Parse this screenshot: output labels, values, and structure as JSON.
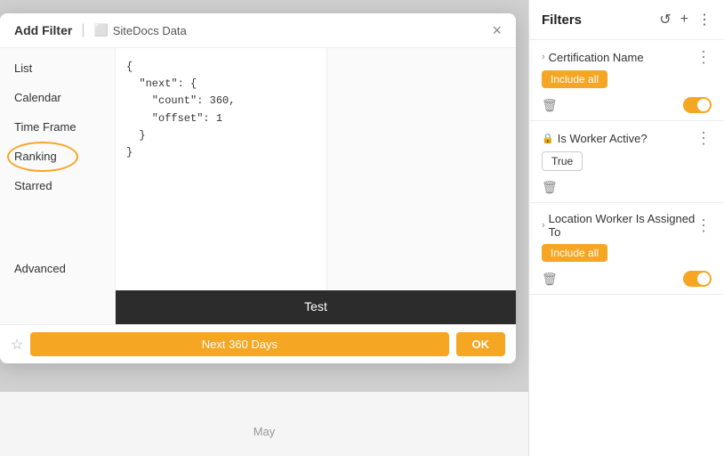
{
  "dialog": {
    "title": "Add Filter",
    "subtitle": "SiteDocs Data",
    "subtitle_icon": "document-icon",
    "close_label": "×",
    "sidebar": {
      "items": [
        {
          "label": "List",
          "active": false
        },
        {
          "label": "Calendar",
          "active": false
        },
        {
          "label": "Time Frame",
          "active": false
        },
        {
          "label": "Ranking",
          "active": true
        },
        {
          "label": "Starred",
          "active": false
        },
        {
          "label": "Advanced",
          "active": false
        }
      ]
    },
    "json_content": "{\n  \"next\": {\n    \"count\": 360,\n    \"offset\": 1\n  }\n}",
    "test_button_label": "Test",
    "footer": {
      "star_label": "☆",
      "period_label": "Next 360 Days",
      "ok_label": "OK"
    }
  },
  "filters_panel": {
    "title": "Filters",
    "refresh_icon": "refresh-icon",
    "add_icon": "plus-icon",
    "more_icon": "more-icon",
    "items": [
      {
        "id": "certification-name",
        "title": "Certification Name",
        "chevron": "›",
        "badge": "Include all",
        "badge_style": "filled",
        "has_toggle": true,
        "toggle_on": true,
        "has_trash": true,
        "more_icon": "⋮"
      },
      {
        "id": "is-worker-active",
        "title": "Is Worker Active?",
        "lock": "🔒",
        "badge": "True",
        "badge_style": "outline",
        "has_toggle": false,
        "has_trash": true,
        "more_icon": "⋮"
      },
      {
        "id": "location-worker",
        "title": "Location Worker Is Assigned To",
        "chevron": "›",
        "badge": "Include all",
        "badge_style": "filled",
        "has_toggle": true,
        "toggle_on": true,
        "has_trash": true,
        "more_icon": "⋮"
      }
    ]
  },
  "calendar": {
    "month_label": "May"
  }
}
